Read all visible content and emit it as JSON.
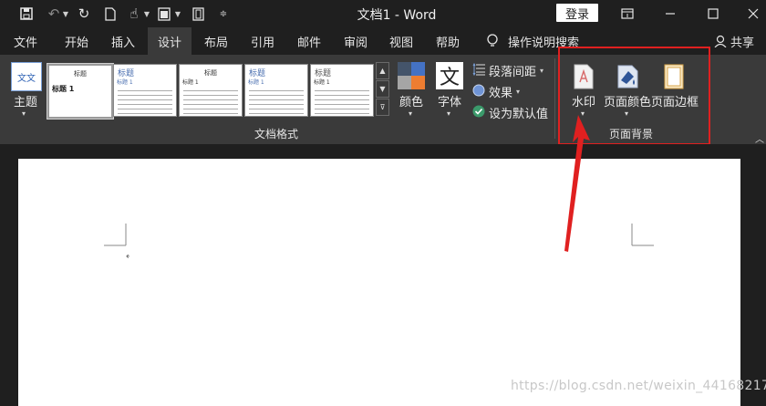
{
  "titlebar": {
    "title": "文档1  -  Word",
    "login_label": "登录",
    "icons": [
      "save-icon",
      "undo-icon",
      "redo-icon",
      "new-document-icon",
      "touch-mode-icon",
      "checkbox-icon",
      "page-icon",
      "customize-icon"
    ]
  },
  "tabs": [
    {
      "label": "文件"
    },
    {
      "label": "开始"
    },
    {
      "label": "插入"
    },
    {
      "label": "设计"
    },
    {
      "label": "布局"
    },
    {
      "label": "引用"
    },
    {
      "label": "邮件"
    },
    {
      "label": "审阅"
    },
    {
      "label": "视图"
    },
    {
      "label": "帮助"
    }
  ],
  "tell_me": "操作说明搜索",
  "share_label": "共享",
  "ribbon": {
    "theme_label": "主题",
    "theme_icon_text": "文文",
    "styles": [
      {
        "title": "标题",
        "heading": "标题 1"
      },
      {
        "title": "标题",
        "heading": "标题 1"
      },
      {
        "title": "标题",
        "heading": "标题 1"
      },
      {
        "title": "标题",
        "heading": "标题 1"
      },
      {
        "title": "标题",
        "heading": "标题 1"
      }
    ],
    "color_label": "颜色",
    "font_label": "字体",
    "font_icon_text": "文",
    "paragraph_spacing_label": "段落间距",
    "effects_label": "效果",
    "set_default_label": "设为默认值",
    "group_document_format": "文档格式",
    "watermark_label": "水印",
    "page_color_label": "页面颜色",
    "page_border_label": "页面边框",
    "group_page_background": "页面背景"
  },
  "footer_watermark": "https://blog.csdn.net/weixin_44168217",
  "colors": {
    "accent_red": "#e02020",
    "ribbon_bg": "#3a3a3a",
    "titlebar_bg": "#1f1f1f"
  }
}
